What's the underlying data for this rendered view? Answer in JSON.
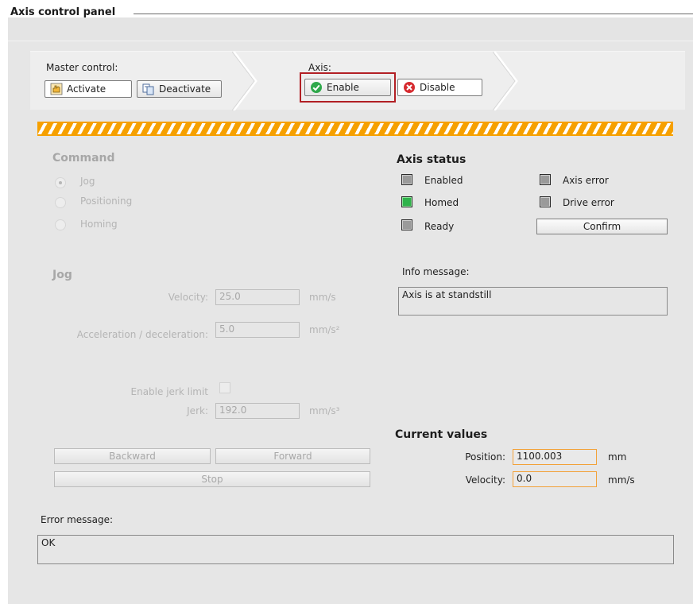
{
  "panel": {
    "title": "Axis control panel"
  },
  "master_control": {
    "label": "Master control:",
    "activate_label": "Activate",
    "deactivate_label": "Deactivate"
  },
  "axis": {
    "label": "Axis:",
    "enable_label": "Enable",
    "disable_label": "Disable"
  },
  "command": {
    "title": "Command",
    "options": [
      "Jog",
      "Positioning",
      "Homing"
    ],
    "selected": "Jog"
  },
  "jog": {
    "title": "Jog",
    "velocity_label": "Velocity:",
    "velocity_value": "25.0",
    "velocity_unit": "mm/s",
    "accel_label": "Acceleration / deceleration:",
    "accel_value": "5.0",
    "accel_unit": "mm/s²",
    "jerk_enable_label": "Enable jerk limit",
    "jerk_label": "Jerk:",
    "jerk_value": "192.0",
    "jerk_unit": "mm/s³",
    "backward_label": "Backward",
    "forward_label": "Forward",
    "stop_label": "Stop"
  },
  "axis_status": {
    "title": "Axis status",
    "enabled_label": "Enabled",
    "homed_label": "Homed",
    "ready_label": "Ready",
    "axis_error_label": "Axis error",
    "drive_error_label": "Drive error",
    "confirm_label": "Confirm",
    "enabled": false,
    "homed": true,
    "ready": false,
    "axis_error": false,
    "drive_error": false
  },
  "info": {
    "label": "Info message:",
    "text": "Axis is at standstill"
  },
  "current_values": {
    "title": "Current values",
    "position_label": "Position:",
    "position_value": "1100.003",
    "position_unit": "mm",
    "velocity_label": "Velocity:",
    "velocity_value": "0.0",
    "velocity_unit": "mm/s"
  },
  "error": {
    "label": "Error message:",
    "text": "OK"
  },
  "colors": {
    "accent_stripe": "#f6a000",
    "enable_highlight": "#b22025",
    "status_green": "#2fb34b",
    "value_border": "#f2a23a"
  }
}
